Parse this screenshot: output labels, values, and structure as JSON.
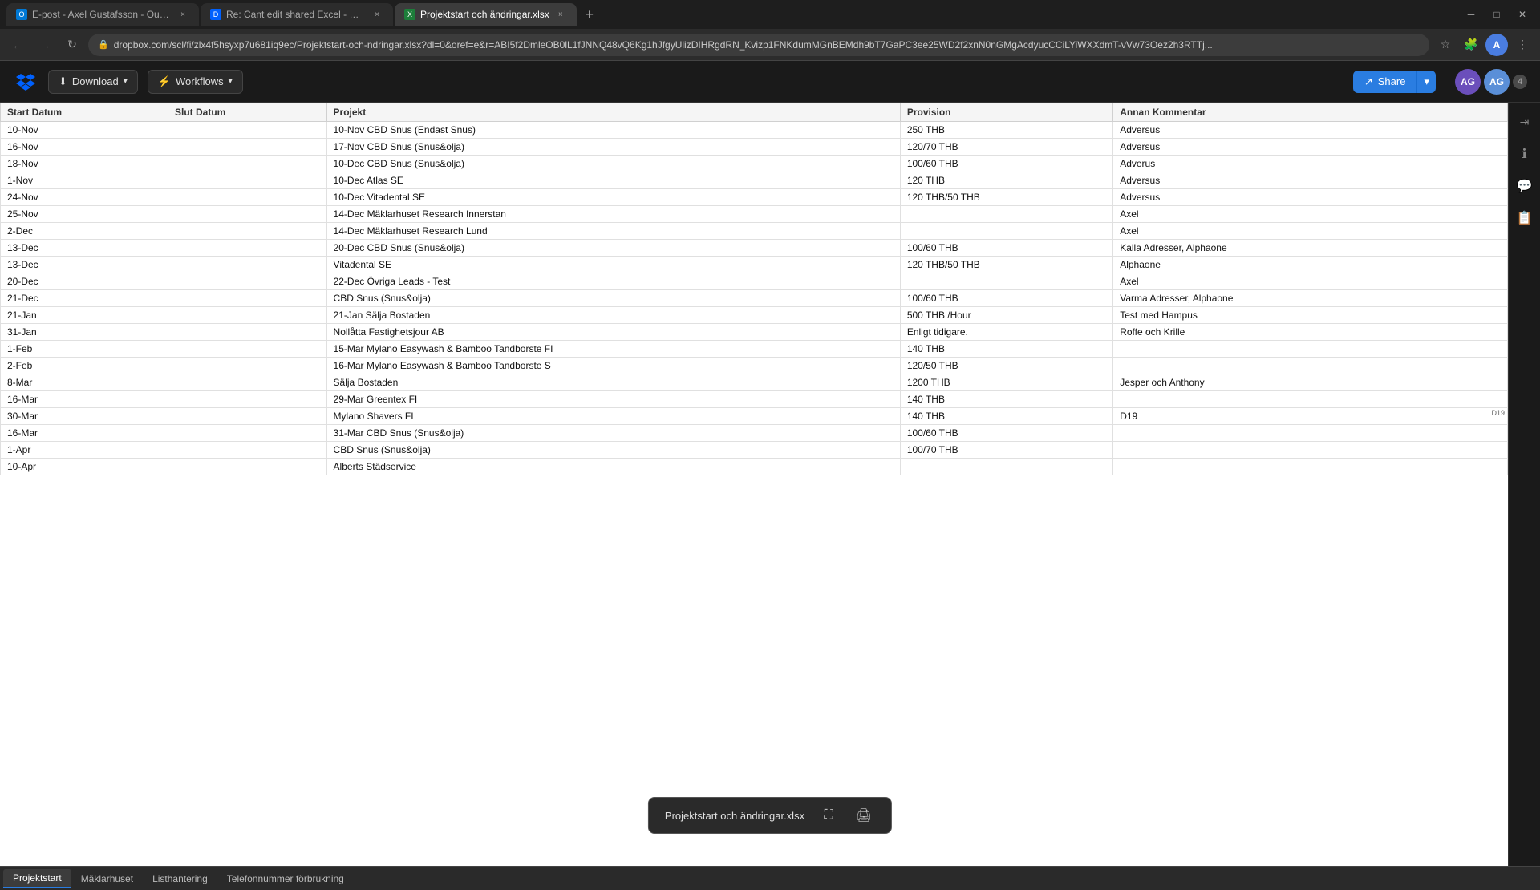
{
  "browser": {
    "tabs": [
      {
        "id": "tab1",
        "label": "E-post - Axel Gustafsson - Outlo...",
        "favicon_color": "#0078d4",
        "favicon_letter": "O",
        "active": false
      },
      {
        "id": "tab2",
        "label": "Re: Cant edit shared Excel - Drop...",
        "favicon_color": "#0061fe",
        "favicon_letter": "D",
        "active": false
      },
      {
        "id": "tab3",
        "label": "Projektstart och ändringar.xlsx",
        "favicon_color": "#1d7e3a",
        "favicon_letter": "X",
        "active": true
      }
    ],
    "url": "dropbox.com/scl/fi/zlx4f5hsyxp7u681iq9ec/Projektstart-och-ndringar.xlsx?dl=0&oref=e&r=ABI5f2DmleOB0lL1fJNNQ48vQ6Kg1hJfgyUlizDIHRgdRN_Kvizp1FNKdumMGnBEMdh9bT7GaPC3ee25WD2f2xnN0nGMgAcdyucCCiLYiWXXdmT-vVw73Oez2h3RTTj..."
  },
  "toolbar": {
    "download_label": "Download",
    "workflows_label": "Workflows",
    "share_label": "Share"
  },
  "spreadsheet": {
    "headers": [
      "Start Datum",
      "Slut Datum",
      "Projekt",
      "Provision",
      "Annan Kommentar"
    ],
    "rows": [
      {
        "start": "10-Nov",
        "slut": "",
        "projekt": "10-Nov CBD Snus (Endast Snus)",
        "provision": "250 THB",
        "kommentar": "Adversus"
      },
      {
        "start": "16-Nov",
        "slut": "",
        "projekt": "17-Nov CBD Snus (Snus&olja)",
        "provision": "120/70 THB",
        "kommentar": "Adversus"
      },
      {
        "start": "18-Nov",
        "slut": "",
        "projekt": "10-Dec CBD Snus (Snus&olja)",
        "provision": "100/60 THB",
        "kommentar": "Adverus"
      },
      {
        "start": "1-Nov",
        "slut": "",
        "projekt": "10-Dec Atlas SE",
        "provision": "120 THB",
        "kommentar": "Adversus"
      },
      {
        "start": "24-Nov",
        "slut": "",
        "projekt": "10-Dec Vitadental SE",
        "provision": "120 THB/50 THB",
        "kommentar": "Adversus"
      },
      {
        "start": "25-Nov",
        "slut": "",
        "projekt": "14-Dec Mäklarhuset Research Innerstan",
        "provision": "",
        "kommentar": "Axel"
      },
      {
        "start": "2-Dec",
        "slut": "",
        "projekt": "14-Dec Mäklarhuset Research Lund",
        "provision": "",
        "kommentar": "Axel"
      },
      {
        "start": "13-Dec",
        "slut": "",
        "projekt": "20-Dec CBD Snus (Snus&olja)",
        "provision": "100/60 THB",
        "kommentar": "Kalla Adresser, Alphaone"
      },
      {
        "start": "13-Dec",
        "slut": "",
        "projekt": "Vitadental SE",
        "provision": "120 THB/50 THB",
        "kommentar": "Alphaone"
      },
      {
        "start": "20-Dec",
        "slut": "",
        "projekt": "22-Dec Övriga Leads - Test",
        "provision": "",
        "kommentar": "Axel"
      },
      {
        "start": "21-Dec",
        "slut": "",
        "projekt": "CBD Snus (Snus&olja)",
        "provision": "100/60 THB",
        "kommentar": "Varma Adresser, Alphaone"
      },
      {
        "start": "21-Jan",
        "slut": "",
        "projekt": "21-Jan Sälja Bostaden",
        "provision": "500 THB /Hour",
        "kommentar": "Test med Hampus"
      },
      {
        "start": "31-Jan",
        "slut": "",
        "projekt": "Nollåtta Fastighetsjour AB",
        "provision": "Enligt tidigare.",
        "kommentar": "Roffe och Krille"
      },
      {
        "start": "1-Feb",
        "slut": "",
        "projekt": "15-Mar Mylano Easywash & Bamboo Tandborste FI",
        "provision": "140 THB",
        "kommentar": ""
      },
      {
        "start": "2-Feb",
        "slut": "",
        "projekt": "16-Mar Mylano Easywash & Bamboo Tandborste S",
        "provision": "120/50 THB",
        "kommentar": ""
      },
      {
        "start": "8-Mar",
        "slut": "",
        "projekt": "Sälja Bostaden",
        "provision": "1200 THB",
        "kommentar": "Jesper och Anthony"
      },
      {
        "start": "16-Mar",
        "slut": "",
        "projekt": "29-Mar Greentex FI",
        "provision": "140 THB",
        "kommentar": ""
      },
      {
        "start": "30-Mar",
        "slut": "",
        "projekt": "Mylano Shavers FI",
        "provision": "140 THB",
        "kommentar": "D19"
      },
      {
        "start": "16-Mar",
        "slut": "",
        "projekt": "31-Mar CBD Snus (Snus&olja)",
        "provision": "100/60 THB",
        "kommentar": ""
      },
      {
        "start": "1-Apr",
        "slut": "",
        "projekt": "CBD Snus (Snus&olja)",
        "provision": "100/70 THB",
        "kommentar": ""
      },
      {
        "start": "10-Apr",
        "slut": "",
        "projekt": "Alberts Städservice",
        "provision": "",
        "kommentar": ""
      }
    ]
  },
  "sheet_tabs": [
    {
      "id": "projektstart",
      "label": "Projektstart",
      "active": true
    },
    {
      "id": "maklarhuset",
      "label": "Mäklarhuset",
      "active": false
    },
    {
      "id": "listhantering",
      "label": "Listhantering",
      "active": false
    },
    {
      "id": "telefonnummer",
      "label": "Telefonnummer förbrukning",
      "active": false
    }
  ],
  "tooltip": {
    "filename": "Projektstart och ändringar.xlsx"
  },
  "avatars": [
    {
      "id": "ag1",
      "initials": "AG",
      "color": "#6b4fbb"
    },
    {
      "id": "ag2",
      "initials": "AG",
      "color": "#5a8fd8"
    }
  ],
  "right_sidebar": {
    "icons": [
      "expand-icon",
      "info-icon",
      "comment-icon",
      "clipboard-icon"
    ]
  }
}
